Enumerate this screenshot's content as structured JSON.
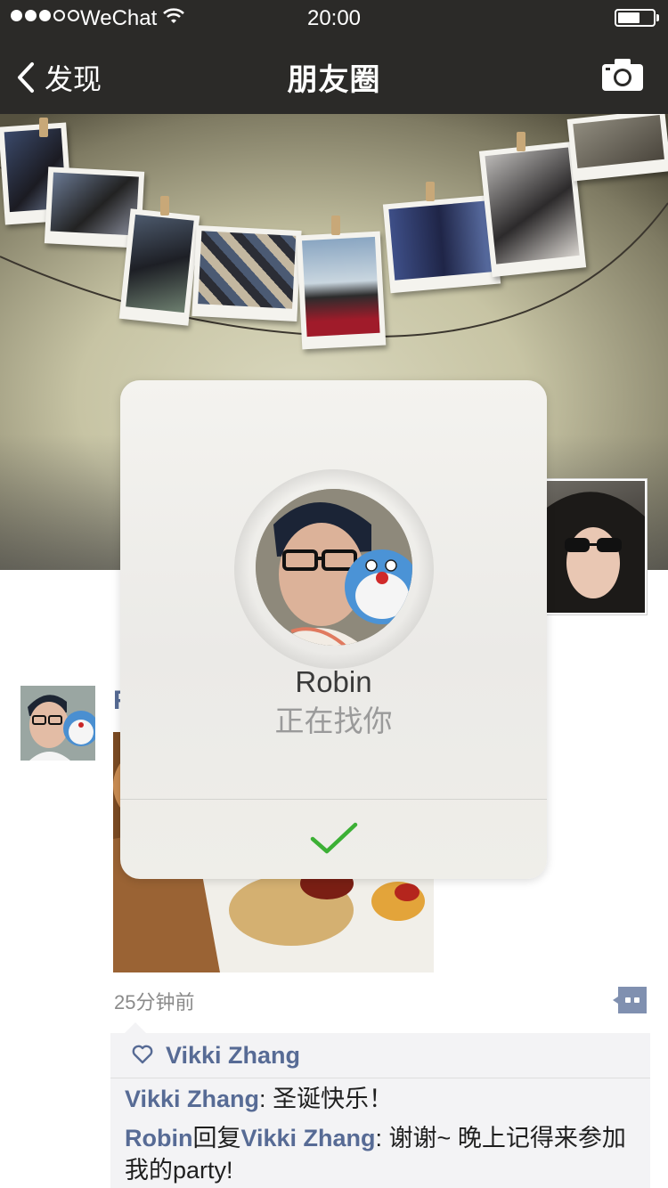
{
  "status_bar": {
    "carrier": "WeChat",
    "time": "20:00"
  },
  "nav": {
    "back_label": "发现",
    "title": "朋友圈"
  },
  "dialog": {
    "name": "Robin",
    "status": "正在找你"
  },
  "post": {
    "author_partial": "R",
    "time": "25分钟前",
    "likes": [
      "Vikki Zhang"
    ],
    "comments": [
      {
        "author": "Vikki Zhang",
        "separator": ": ",
        "text": "圣诞快乐！"
      },
      {
        "author": "Robin",
        "reply_word": "回复",
        "reply_to": "Vikki Zhang",
        "separator": ": ",
        "text": "谢谢~ 晚上记得来参加我的party!"
      }
    ]
  },
  "colors": {
    "bar_bg": "#2b2a28",
    "link_blue": "#576b95",
    "confirm_green": "#3cb035"
  },
  "icons": [
    "wifi-icon",
    "battery-icon",
    "back-chevron-icon",
    "camera-icon",
    "comment-icon",
    "heart-icon",
    "check-icon"
  ]
}
